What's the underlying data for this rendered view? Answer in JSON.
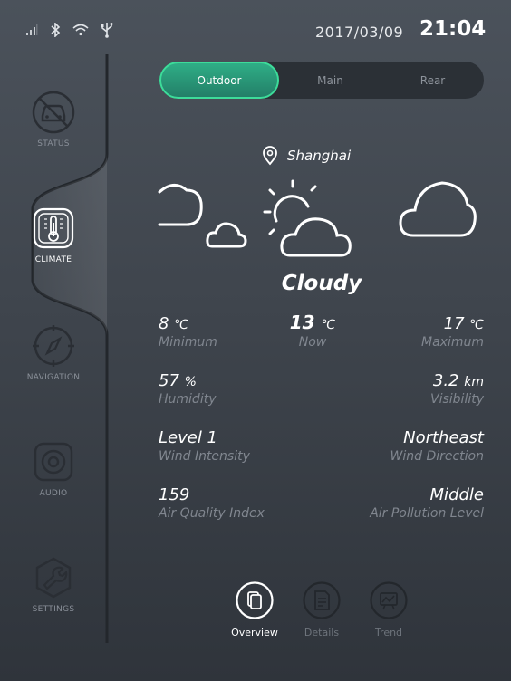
{
  "status_bar": {
    "date": "2017/03/09",
    "time": "21:04",
    "icons": [
      "signal-icon",
      "bluetooth-icon",
      "wifi-icon",
      "usb-icon"
    ]
  },
  "sidebar": {
    "items": [
      {
        "label": "STATUS",
        "icon": "car-status-icon",
        "active": false
      },
      {
        "label": "CLIMATE",
        "icon": "thermometer-icon",
        "active": true
      },
      {
        "label": "NAVIGATION",
        "icon": "compass-icon",
        "active": false
      },
      {
        "label": "AUDIO",
        "icon": "speaker-icon",
        "active": false
      },
      {
        "label": "SETTINGS",
        "icon": "wrench-icon",
        "active": false
      }
    ]
  },
  "tabs": [
    {
      "label": "Outdoor",
      "active": true
    },
    {
      "label": "Main",
      "active": false
    },
    {
      "label": "Rear",
      "active": false
    }
  ],
  "location": {
    "name": "Shanghai",
    "icon": "location-pin-icon"
  },
  "condition": "Cloudy",
  "metrics": {
    "minimum": {
      "value": "8",
      "unit": "℃",
      "label": "Minimum"
    },
    "now": {
      "value": "13",
      "unit": "℃",
      "label": "Now"
    },
    "maximum": {
      "value": "17",
      "unit": "℃",
      "label": "Maximum"
    },
    "humidity": {
      "value": "57",
      "unit": "%",
      "label": "Humidity"
    },
    "visibility": {
      "value": "3.2",
      "unit": "km",
      "label": "Visibility"
    },
    "wind_intensity": {
      "value": "Level 1",
      "label": "Wind Intensity"
    },
    "wind_direction": {
      "value": "Northeast",
      "label": "Wind Direction"
    },
    "aqi": {
      "value": "159",
      "label": "Air Quality Index"
    },
    "pollution": {
      "value": "Middle",
      "label": "Air Pollution Level"
    }
  },
  "bottom_nav": [
    {
      "label": "Overview",
      "icon": "overview-icon",
      "active": true
    },
    {
      "label": "Details",
      "icon": "details-icon",
      "active": false
    },
    {
      "label": "Trend",
      "icon": "trend-icon",
      "active": false
    }
  ],
  "colors": {
    "accent": "#3ddc9a",
    "accent_dark": "#237f68",
    "muted": "#80868f"
  }
}
